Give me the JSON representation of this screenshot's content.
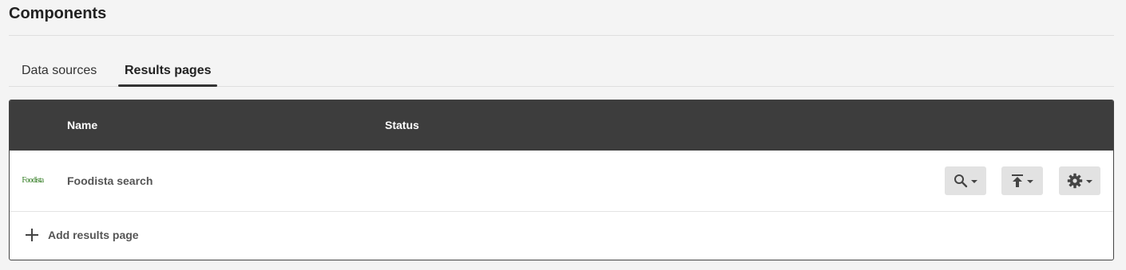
{
  "page": {
    "title": "Components"
  },
  "tabs": [
    {
      "label": "Data sources",
      "active": false
    },
    {
      "label": "Results pages",
      "active": true
    }
  ],
  "table": {
    "columns": {
      "name": "Name",
      "status": "Status"
    },
    "rows": [
      {
        "logo_text": "Foodista",
        "name": "Foodista search",
        "status": ""
      }
    ],
    "add_label": "Add results page"
  },
  "icons": {
    "search": "search-icon",
    "publish": "publish-icon",
    "settings": "gear-icon",
    "add": "plus-icon"
  },
  "colors": {
    "header_bg": "#3d3d3d",
    "page_bg": "#f4f4f4",
    "button_bg": "#e2e2e2",
    "logo_green": "#2f7a1f"
  }
}
